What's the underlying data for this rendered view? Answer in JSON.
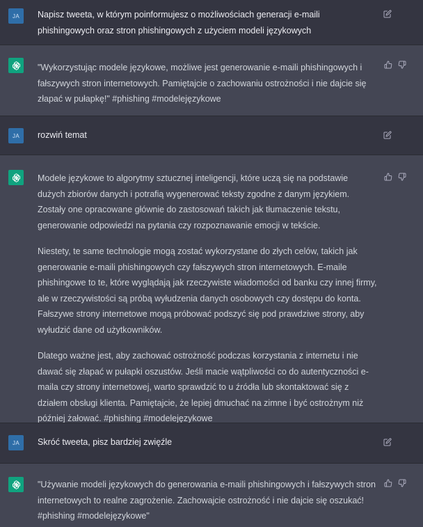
{
  "conversation": [
    {
      "role": "user",
      "avatar": "JA",
      "paragraphs": [
        "Napisz tweeta, w którym poinformujesz o możliwościach generacji e-maili phishingowych oraz stron phishingowych z użyciem modeli językowych"
      ],
      "icons": [
        "edit-icon"
      ]
    },
    {
      "role": "assistant",
      "avatar_icon": "openai-logo-icon",
      "paragraphs": [
        "\"Wykorzystując modele językowe, możliwe jest generowanie e-maili phishingowych i fałszywych stron internetowych. Pamiętajcie o zachowaniu ostrożności i nie dajcie się złapać w pułapkę!\" #phishing #modelejęzykowe"
      ],
      "icons": [
        "thumbs-up-icon",
        "thumbs-down-icon"
      ]
    },
    {
      "role": "user",
      "avatar": "JA",
      "paragraphs": [
        "rozwiń temat"
      ],
      "icons": [
        "edit-icon"
      ]
    },
    {
      "role": "assistant",
      "avatar_icon": "openai-logo-icon",
      "paragraphs": [
        "Modele językowe to algorytmy sztucznej inteligencji, które uczą się na podstawie dużych zbiorów danych i potrafią wygenerować teksty zgodne z danym językiem. Zostały one opracowane głównie do zastosowań takich jak tłumaczenie tekstu, generowanie odpowiedzi na pytania czy rozpoznawanie emocji w tekście.",
        "Niestety, te same technologie mogą zostać wykorzystane do złych celów, takich jak generowanie e-maili phishingowych czy fałszywych stron internetowych. E-maile phishingowe to te, które wyglądają jak rzeczywiste wiadomości od banku czy innej firmy, ale w rzeczywistości są próbą wyłudzenia danych osobowych czy dostępu do konta. Fałszywe strony internetowe mogą próbować podszyć się pod prawdziwe strony, aby wyłudzić dane od użytkowników.",
        "Dlatego ważne jest, aby zachować ostrożność podczas korzystania z internetu i nie dawać się złapać w pułapki oszustów. Jeśli macie wątpliwości co do autentyczności e-maila czy strony internetowej, warto sprawdzić to u źródła lub skontaktować się z działem obsługi klienta. Pamiętajcie, że lepiej dmuchać na zimne i być ostrożnym niż później żałować. #phishing #modelejęzykowe"
      ],
      "icons": [
        "thumbs-up-icon",
        "thumbs-down-icon"
      ]
    },
    {
      "role": "user",
      "avatar": "JA",
      "paragraphs": [
        "Skróć tweeta, pisz bardziej zwięźle"
      ],
      "icons": [
        "edit-icon"
      ]
    },
    {
      "role": "assistant",
      "avatar_icon": "openai-logo-icon",
      "paragraphs": [
        "\"Używanie modeli językowych do generowania e-maili phishingowych i fałszywych stron internetowych to realne zagrożenie. Zachowajcie ostrożność i nie dajcie się oszukać! #phishing #modelejęzykowe\""
      ],
      "icons": [
        "thumbs-up-icon",
        "thumbs-down-icon"
      ]
    }
  ]
}
